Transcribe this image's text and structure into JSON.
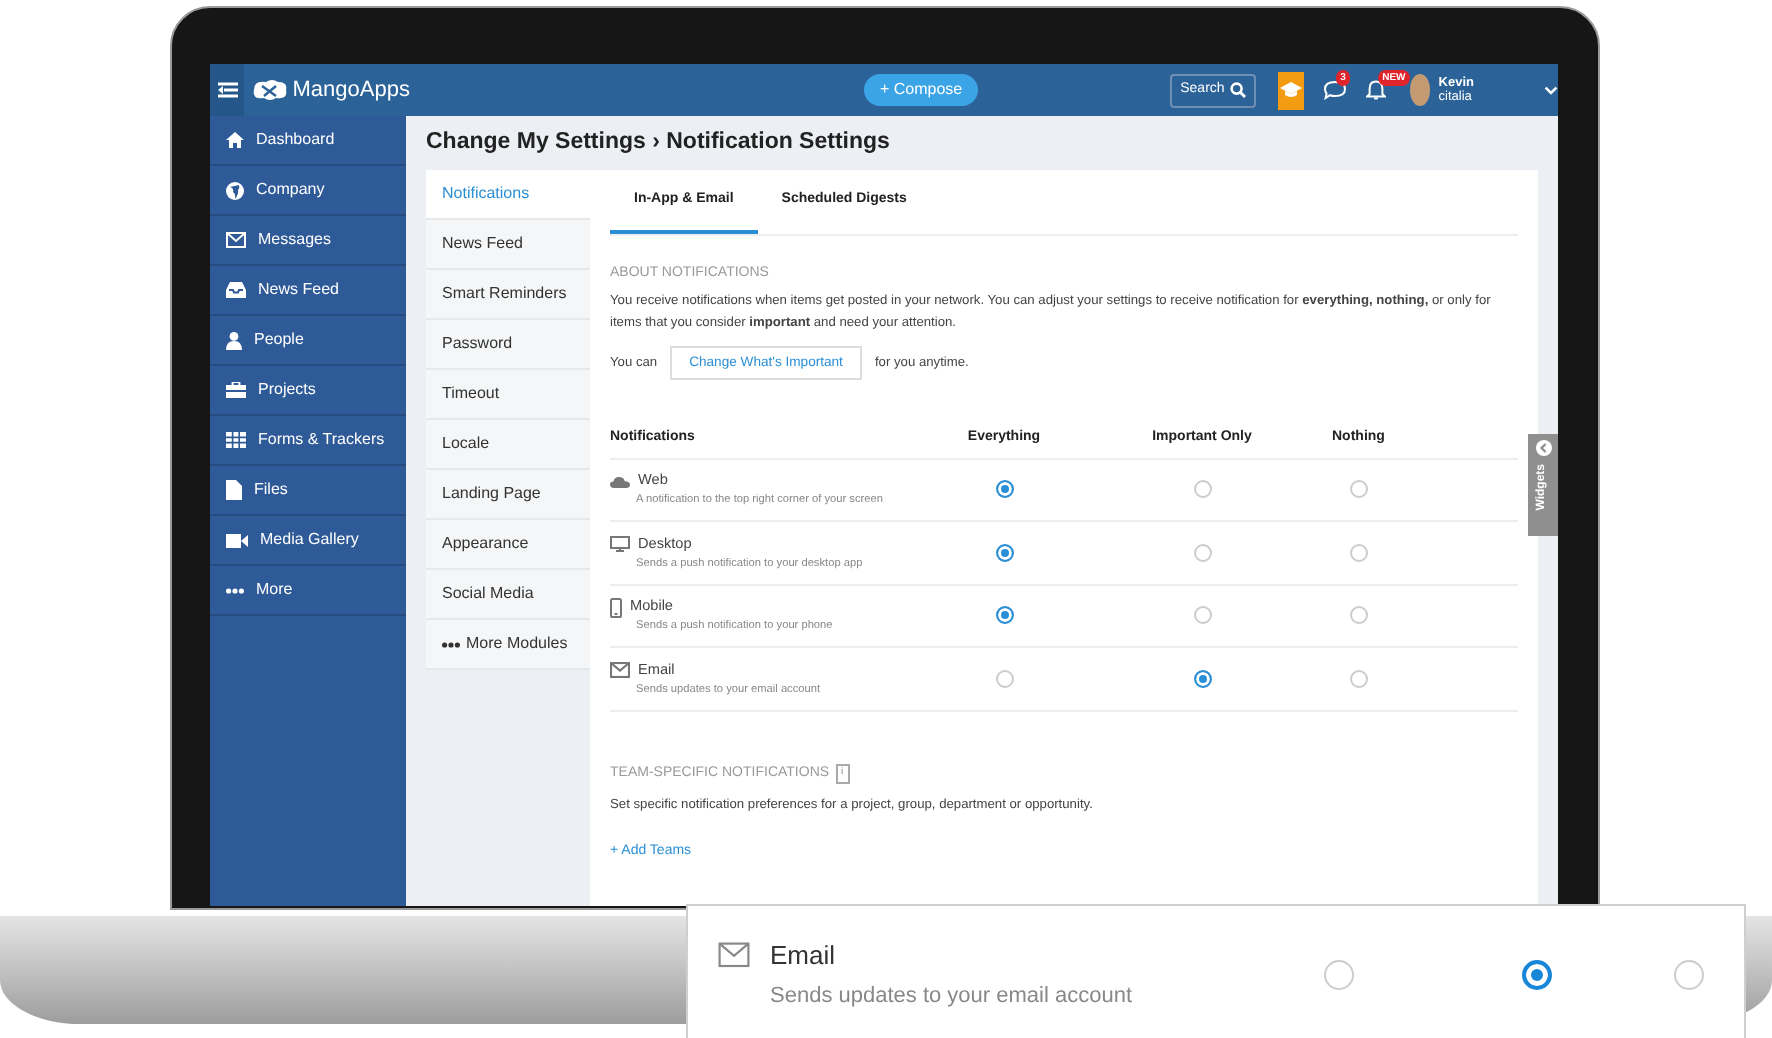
{
  "topbar": {
    "logo": "MangoApps",
    "compose": "+ Compose",
    "search": "Search",
    "chat_badge": "3",
    "bell_badge": "NEW",
    "user_name": "Kevin",
    "user_sub": "citalia"
  },
  "sidebar": {
    "items": [
      {
        "label": "Dashboard",
        "kind": "home"
      },
      {
        "label": "Company",
        "kind": "globe"
      },
      {
        "label": "Messages",
        "kind": "mail"
      },
      {
        "label": "News Feed",
        "kind": "inbox"
      },
      {
        "label": "People",
        "kind": "person"
      },
      {
        "label": "Projects",
        "kind": "briefcase"
      },
      {
        "label": "Forms & Trackers",
        "kind": "grid"
      },
      {
        "label": "Files",
        "kind": "file"
      },
      {
        "label": "Media Gallery",
        "kind": "video"
      },
      {
        "label": "More",
        "kind": "dots"
      }
    ]
  },
  "page_title": "Change My Settings › Notification Settings",
  "settings_nav": [
    {
      "label": "Notifications",
      "selected": true
    },
    {
      "label": "News Feed",
      "selected": false
    },
    {
      "label": "Smart Reminders",
      "selected": false
    },
    {
      "label": "Password",
      "selected": false
    },
    {
      "label": "Timeout",
      "selected": false
    },
    {
      "label": "Locale",
      "selected": false
    },
    {
      "label": "Landing Page",
      "selected": false
    },
    {
      "label": "Appearance",
      "selected": false
    },
    {
      "label": "Social Media",
      "selected": false
    },
    {
      "label": "More Modules",
      "selected": false,
      "kind": "dots"
    }
  ],
  "tabs": [
    {
      "label": "In-App & Email",
      "selected": true
    },
    {
      "label": "Scheduled Digests",
      "selected": false
    }
  ],
  "about": {
    "heading": "ABOUT NOTIFICATIONS",
    "text": "You receive notifications when items get posted in your network. You can adjust your settings to receive notification for **everything, nothing,** or only for items that you consider **important** and need your attention.",
    "prefix": "You can",
    "button": "Change What's Important",
    "suffix": "for you anytime."
  },
  "table": {
    "columns": [
      "Notifications",
      "Everything",
      "Important Only",
      "Nothing"
    ],
    "rows": [
      {
        "kind": "web",
        "name": "Web",
        "description": "A notification to the top right corner of your screen",
        "options": [
          {
            "selected": true
          },
          {
            "selected": false
          },
          {
            "selected": false
          }
        ]
      },
      {
        "kind": "desktop",
        "name": "Desktop",
        "description": "Sends a push notification to your desktop app",
        "options": [
          {
            "selected": true
          },
          {
            "selected": false
          },
          {
            "selected": false
          }
        ]
      },
      {
        "kind": "mobile",
        "name": "Mobile",
        "description": "Sends a push notification to your phone",
        "options": [
          {
            "selected": true
          },
          {
            "selected": false
          },
          {
            "selected": false
          }
        ]
      },
      {
        "kind": "email",
        "name": "Email",
        "description": "Sends updates to your email account",
        "options": [
          {
            "selected": false
          },
          {
            "selected": true
          },
          {
            "selected": false
          }
        ]
      }
    ]
  },
  "team": {
    "heading": "TEAM-SPECIFIC NOTIFICATIONS",
    "info": "i",
    "text": "Set specific notification preferences for a project, group, department or opportunity.",
    "link": "+ Add Teams"
  },
  "widgets_tab": "Widgets",
  "callout": {
    "kind": "email",
    "name": "Email",
    "description": "Sends updates to your email account",
    "options": [
      {
        "selected": false
      },
      {
        "selected": true
      },
      {
        "selected": false
      }
    ]
  }
}
